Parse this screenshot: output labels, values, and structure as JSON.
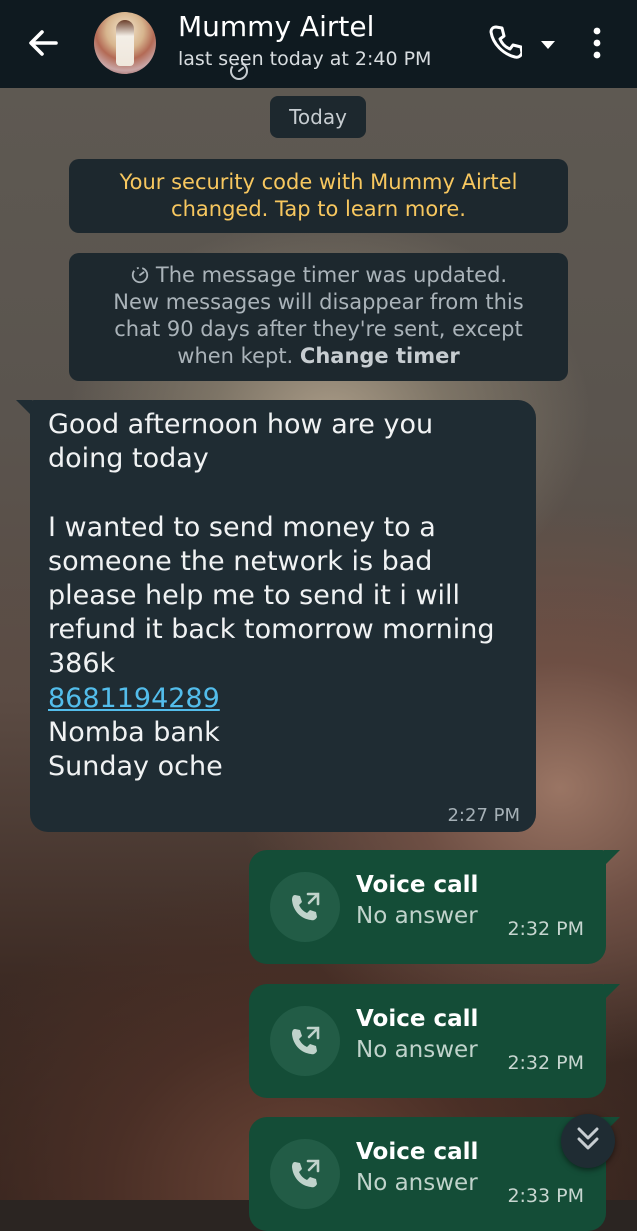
{
  "header": {
    "contact_name": "Mummy Airtel",
    "last_seen": "last seen today at 2:40 PM",
    "icons": [
      "back-arrow-icon",
      "timer-icon",
      "call-icon",
      "caret-down-icon",
      "more-vert-icon"
    ]
  },
  "chat": {
    "date_chip": "Today",
    "security_notice": [
      "Your security code with Mummy Airtel",
      "changed. Tap to learn more."
    ],
    "timer_notice": {
      "line1": "The message timer was updated.",
      "line2": "New messages will disappear from this",
      "line3": "chat 90 days after they're sent, except",
      "line4_prefix": "when kept.",
      "link": "Change timer"
    },
    "incoming_message": {
      "text": "Good afternoon how are you\ndoing today\n\nI wanted to send money to a\nsomeone the network is bad\nplease help me to send it i will\nrefund it back tomorrow morning\n386k\n",
      "link_number": "8681194289",
      "after_link": "Nomba bank\nSunday oche",
      "time": "2:27 PM"
    },
    "calls": [
      {
        "title": "Voice call",
        "status": "No answer",
        "time": "2:32 PM"
      },
      {
        "title": "Voice call",
        "status": "No answer",
        "time": "2:32 PM"
      },
      {
        "title": "Voice call",
        "status": "No answer",
        "time": "2:33 PM"
      }
    ]
  },
  "colors": {
    "header_bg": "#0f1a20",
    "incoming_bubble": "#1f2c33",
    "outgoing_bubble": "#144d37",
    "security_text": "#f7c75f",
    "link": "#53bdeb"
  }
}
